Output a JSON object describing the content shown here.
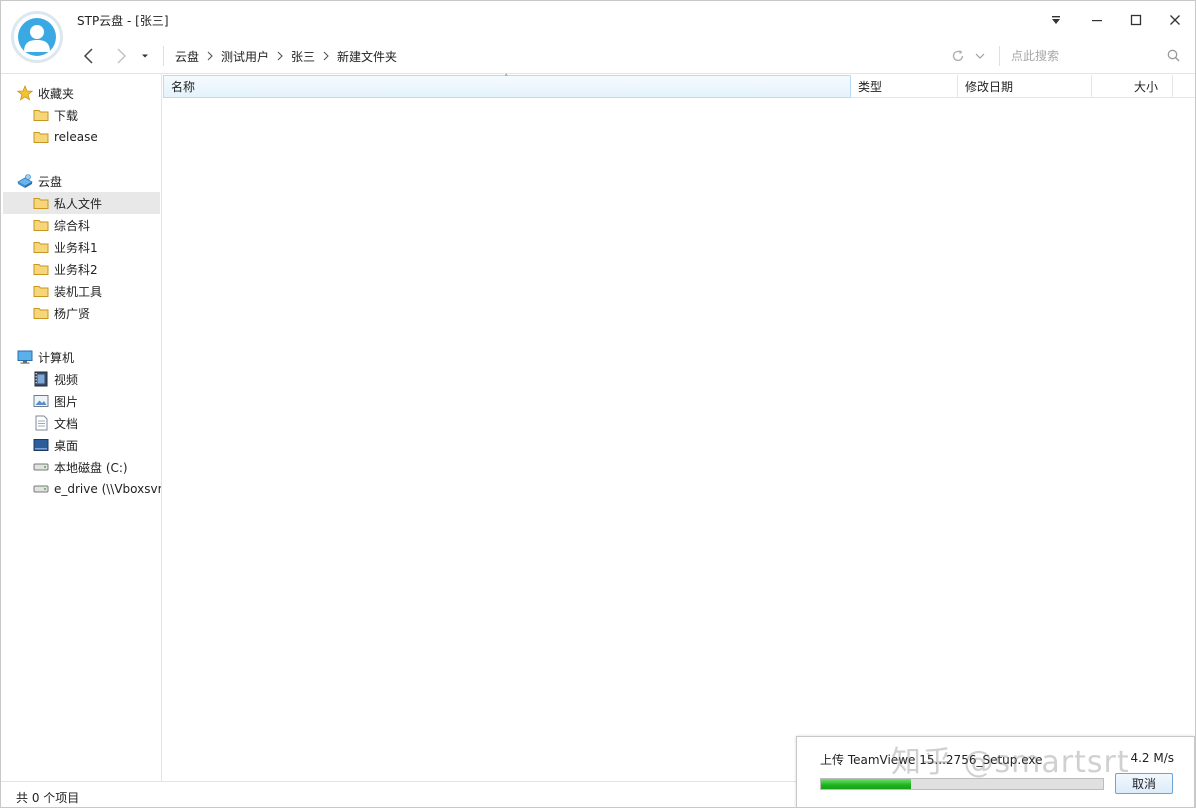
{
  "window": {
    "title": "STP云盘 - [张三]"
  },
  "nav": {
    "breadcrumb": [
      "云盘",
      "测试用户",
      "张三",
      "新建文件夹"
    ],
    "search_placeholder": "点此搜索"
  },
  "sidebar": {
    "favorites": {
      "label": "收藏夹",
      "items": [
        {
          "label": "下载",
          "icon": "folder-icon"
        },
        {
          "label": "release",
          "icon": "folder-icon"
        }
      ]
    },
    "cloud": {
      "label": "云盘",
      "items": [
        {
          "label": "私人文件",
          "icon": "folder-icon",
          "selected": true
        },
        {
          "label": "综合科",
          "icon": "folder-icon"
        },
        {
          "label": "业务科1",
          "icon": "folder-icon"
        },
        {
          "label": "业务科2",
          "icon": "folder-icon"
        },
        {
          "label": "装机工具",
          "icon": "folder-icon"
        },
        {
          "label": "杨广贤",
          "icon": "folder-icon"
        }
      ]
    },
    "computer": {
      "label": "计算机",
      "items": [
        {
          "label": "视频",
          "icon": "video-icon"
        },
        {
          "label": "图片",
          "icon": "picture-icon"
        },
        {
          "label": "文档",
          "icon": "document-icon"
        },
        {
          "label": "桌面",
          "icon": "desktop-icon"
        },
        {
          "label": "本地磁盘 (C:)",
          "icon": "drive-icon"
        },
        {
          "label": "e_drive (\\\\Vboxsvr",
          "icon": "network-drive-icon"
        }
      ]
    }
  },
  "list": {
    "columns": {
      "name": "名称",
      "type": "类型",
      "date": "修改日期",
      "size": "大小"
    },
    "sort_indicator": "˄"
  },
  "status": {
    "text": "共 0 个项目"
  },
  "transfer": {
    "label": "上传  TeamViewe 15...2756_Setup.exe",
    "speed": "4.2 M/s",
    "progress": 0.32,
    "cancel_label": "取消"
  },
  "watermark": "知乎 @smartsrt",
  "colors": {
    "accent": "#3aa9e3",
    "progress_fill": "#1fb31f",
    "folder": "#e8b94a"
  }
}
